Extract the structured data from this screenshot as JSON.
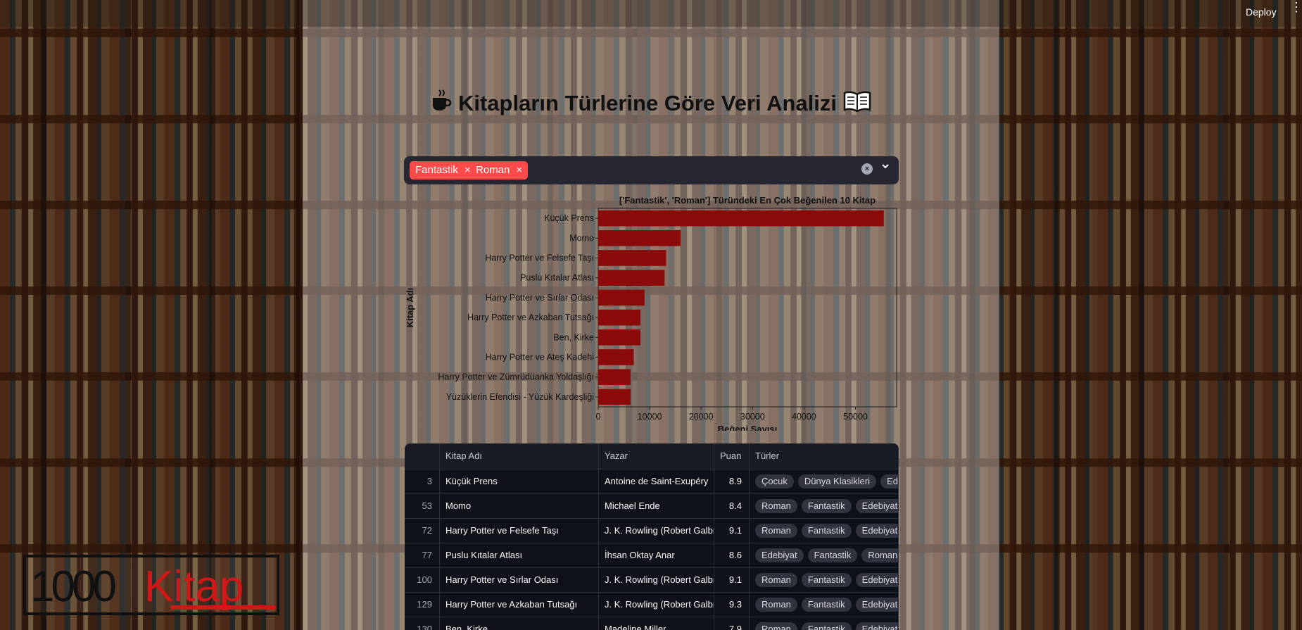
{
  "app": {
    "deploy_label": "Deploy",
    "menu_icon": "vertical-dots-icon"
  },
  "title": {
    "text": "Kitapların Türlerine Göre Veri Analizi",
    "left_icon": "coffee-cup-icon",
    "right_icon": "open-book-icon"
  },
  "filter": {
    "selected": [
      "Fantastik",
      "Roman"
    ],
    "tag_color": "#ff4b4b",
    "clear_icon": "clear-circle-icon",
    "dropdown_icon": "chevron-down-icon"
  },
  "chart_data": {
    "type": "bar",
    "orientation": "horizontal",
    "title": "['Fantastik', 'Roman'] Türündeki En Çok Beğenilen 10 Kitap",
    "xlabel": "Beğeni Sayısı",
    "ylabel": "Kitap Adı",
    "categories": [
      "Küçük Prens",
      "Momo",
      "Harry Potter ve Felsefe Taşı",
      "Puslu Kıtalar Atlası",
      "Harry Potter ve Sırlar Odası",
      "Harry Potter ve Azkaban Tutsağı",
      "Ben, Kirke",
      "Harry Potter ve Ateş Kadehi",
      "Harry Potter ve Zümrüdüanka Yoldaşlığı",
      "Yüzüklerin Efendisi - Yüzük Kardeşliği"
    ],
    "values": [
      55500,
      16000,
      13200,
      12900,
      9000,
      8200,
      8200,
      6900,
      6300,
      6300
    ],
    "xlim": [
      0,
      58000
    ],
    "xticks": [
      0,
      10000,
      20000,
      30000,
      40000,
      50000
    ],
    "bar_color": "#8b0a0a",
    "grid": false
  },
  "table": {
    "columns": [
      "",
      "Kitap Adı",
      "Yazar",
      "Puan",
      "Türler"
    ],
    "rows": [
      {
        "index": "3",
        "title": "Küçük Prens",
        "author": "Antoine de Saint-Exupéry",
        "score": "8.9",
        "genres": [
          "Çocuk",
          "Dünya Klasikleri",
          "Edebiyat"
        ]
      },
      {
        "index": "53",
        "title": "Momo",
        "author": "Michael Ende",
        "score": "8.4",
        "genres": [
          "Roman",
          "Fantastik",
          "Edebiyat"
        ]
      },
      {
        "index": "72",
        "title": "Harry Potter ve Felsefe Taşı",
        "author": "J. K. Rowling (Robert Galbraith)",
        "score": "9.1",
        "genres": [
          "Roman",
          "Fantastik",
          "Edebiyat"
        ]
      },
      {
        "index": "77",
        "title": "Puslu Kıtalar Atlası",
        "author": "İhsan Oktay Anar",
        "score": "8.6",
        "genres": [
          "Edebiyat",
          "Fantastik",
          "Roman"
        ]
      },
      {
        "index": "100",
        "title": "Harry Potter ve Sırlar Odası",
        "author": "J. K. Rowling (Robert Galbraith)",
        "score": "9.1",
        "genres": [
          "Roman",
          "Fantastik",
          "Edebiyat"
        ]
      },
      {
        "index": "129",
        "title": "Harry Potter ve Azkaban Tutsağı",
        "author": "J. K. Rowling (Robert Galbraith)",
        "score": "9.3",
        "genres": [
          "Roman",
          "Fantastik",
          "Edebiyat"
        ]
      },
      {
        "index": "130",
        "title": "Ben, Kirke",
        "author": "Madeline Miller",
        "score": "7.9",
        "genres": [
          "Roman",
          "Fantastik",
          "Edebiyat"
        ]
      }
    ]
  },
  "logo": {
    "text_number": "1000",
    "text_word": "Kitap"
  }
}
